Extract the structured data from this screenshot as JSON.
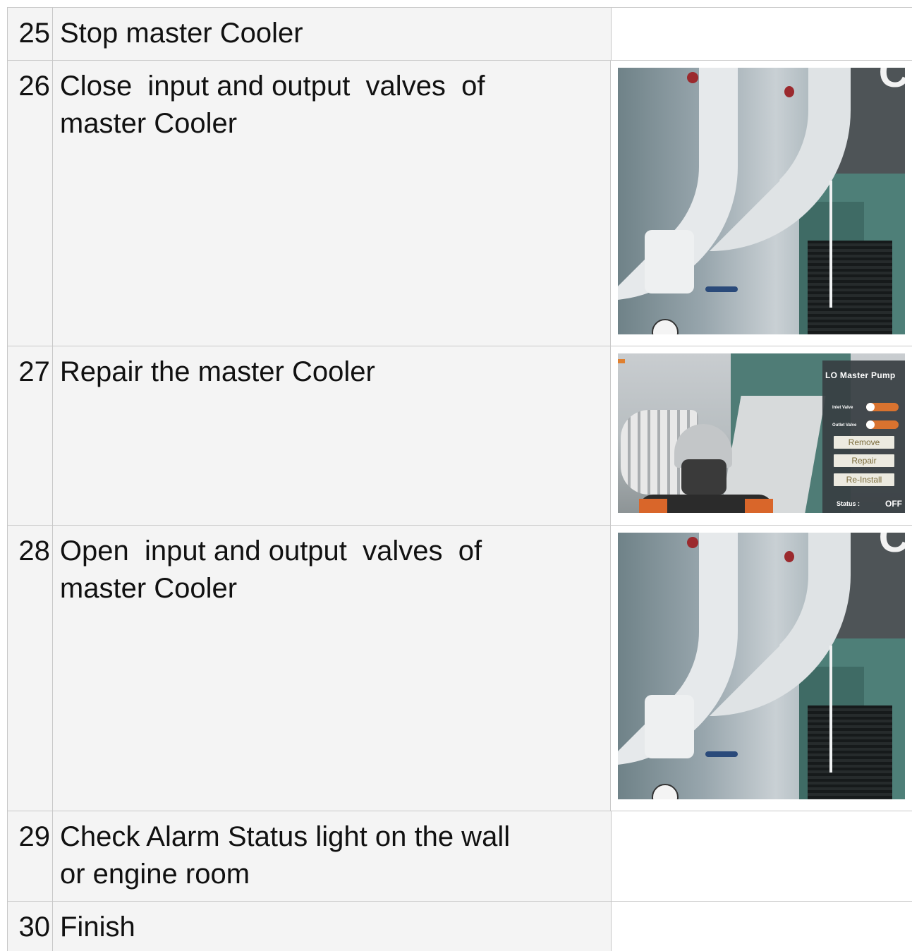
{
  "steps": [
    {
      "num": "25",
      "text": "Stop master Cooler"
    },
    {
      "num": "26",
      "text": "Close  input and output  valves  of\nmaster Cooler"
    },
    {
      "num": "27",
      "text": "Repair the master Cooler"
    },
    {
      "num": "28",
      "text": "Open  input and output  valves  of\nmaster Cooler"
    },
    {
      "num": "29",
      "text": "Check Alarm Status light on the wall\nor engine room"
    },
    {
      "num": "30",
      "text": "Finish"
    }
  ],
  "pipes_sign_partial": "C",
  "panel": {
    "title": "LO Master Pump",
    "inlet_valve": "Inlet Valve",
    "outlet_valve": "Outlet Valve",
    "remove": "Remove",
    "repair": "Repair",
    "reinstall": "Re-Install",
    "status_label": "Status :",
    "status_value": "OFF"
  }
}
